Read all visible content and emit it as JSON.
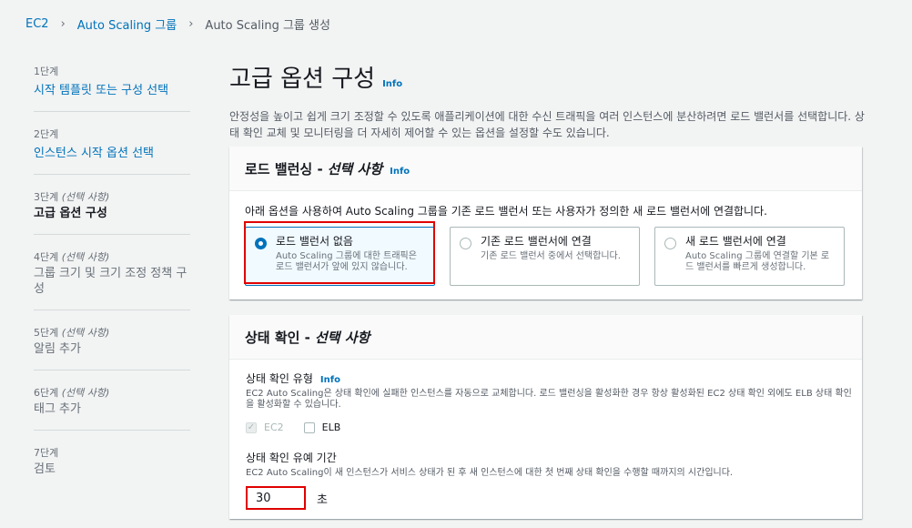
{
  "breadcrumb": {
    "items": [
      "EC2",
      "Auto Scaling 그룹",
      "Auto Scaling 그룹 생성"
    ],
    "separator": "›"
  },
  "nav": {
    "steps": [
      {
        "num": "1단계",
        "optional": "",
        "title": "시작 템플릿 또는 구성 선택"
      },
      {
        "num": "2단계",
        "optional": "",
        "title": "인스턴스 시작 옵션 선택"
      },
      {
        "num": "3단계",
        "optional": "(선택 사항)",
        "title": "고급 옵션 구성"
      },
      {
        "num": "4단계",
        "optional": "(선택 사항)",
        "title": "그룹 크기 및 크기 조정 정책 구성"
      },
      {
        "num": "5단계",
        "optional": "(선택 사항)",
        "title": "알림 추가"
      },
      {
        "num": "6단계",
        "optional": "(선택 사항)",
        "title": "태그 추가"
      },
      {
        "num": "7단계",
        "optional": "",
        "title": "검토"
      }
    ]
  },
  "main": {
    "title": "고급 옵션 구성",
    "info": "Info",
    "description": "안정성을 높이고 쉽게 크기 조정할 수 있도록 애플리케이션에 대한 수신 트래픽을 여러 인스턴스에 분산하려면 로드 밸런서를 선택합니다. 상태 확인 교체 및 모니터링을 더 자세히 제어할 수 있는 옵션을 설정할 수도 있습니다."
  },
  "load_balancing": {
    "title": "로드 밸런싱 -",
    "title_optional": "선택 사항",
    "info": "Info",
    "description": "아래 옵션을 사용하여 Auto Scaling 그룹을 기존 로드 밸런서 또는 사용자가 정의한 새 로드 밸런서에 연결합니다.",
    "options": [
      {
        "label": "로드 밸런서 없음",
        "desc": "Auto Scaling 그룹에 대한 트래픽은 로드 밸런서가 앞에 있지 않습니다.",
        "selected": true
      },
      {
        "label": "기존 로드 밸런서에 연결",
        "desc": "기존 로드 밸런서 중에서 선택합니다.",
        "selected": false
      },
      {
        "label": "새 로드 밸런서에 연결",
        "desc": "Auto Scaling 그룹에 연결할 기본 로드 밸런서를 빠르게 생성합니다.",
        "selected": false
      }
    ]
  },
  "health_check": {
    "title": "상태 확인 -",
    "title_optional": "선택 사항",
    "type_label": "상태 확인 유형",
    "type_info": "Info",
    "type_desc": "EC2 Auto Scaling은 상태 확인에 실패한 인스턴스를 자동으로 교체합니다. 로드 밸런싱을 활성화한 경우 항상 활성화된 EC2 상태 확인 외에도 ELB 상태 확인을 활성화할 수 있습니다.",
    "checks": [
      {
        "label": "EC2",
        "checked": true,
        "disabled": true
      },
      {
        "label": "ELB",
        "checked": false,
        "disabled": false
      }
    ],
    "grace_label": "상태 확인 유예 기간",
    "grace_desc": "EC2 Auto Scaling이 새 인스턴스가 서비스 상태가 된 후 새 인스턴스에 대한 첫 번째 상태 확인을 수행할 때까지의 시간입니다.",
    "grace_value": "30",
    "grace_unit": "초"
  },
  "colors": {
    "link": "#0073bb",
    "highlight": "#e00000",
    "background": "#f2f3f3"
  }
}
